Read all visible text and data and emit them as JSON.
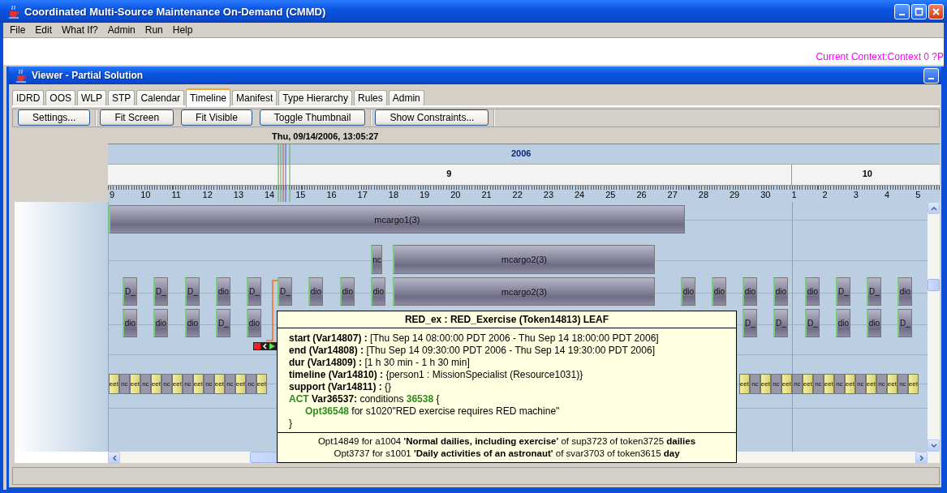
{
  "window": {
    "title": "Coordinated Multi-Source Maintenance On-Demand (CMMD)"
  },
  "menu": [
    "File",
    "Edit",
    "What If?",
    "Admin",
    "Run",
    "Help"
  ],
  "context_label": "Current Context:Context 0 ?P",
  "viewer": {
    "title": "Viewer - Partial Solution"
  },
  "tabs": [
    {
      "label": "IDRD",
      "selected": false
    },
    {
      "label": "OOS",
      "selected": false
    },
    {
      "label": "WLP",
      "selected": false
    },
    {
      "label": "STP",
      "selected": false
    },
    {
      "label": "Calendar",
      "selected": false
    },
    {
      "label": "Timeline",
      "selected": true
    },
    {
      "label": "Manifest",
      "selected": false
    },
    {
      "label": "Type Hierarchy",
      "selected": false
    },
    {
      "label": "Rules",
      "selected": false
    },
    {
      "label": "Admin",
      "selected": false
    }
  ],
  "toolbar": {
    "groups": [
      {
        "buttons": [
          "Settings..."
        ]
      },
      {
        "buttons": [
          "Fit Screen",
          "Fit Visible",
          "Toggle Thumbnail"
        ]
      },
      {
        "buttons": [
          "Show Constraints..."
        ]
      }
    ]
  },
  "timeline": {
    "cursor_time": "Thu, 09/14/2006, 13:05:27",
    "year": "2006",
    "months": [
      {
        "label": "9"
      },
      {
        "label": "10"
      }
    ],
    "days": [
      "9",
      "10",
      "11",
      "12",
      "13",
      "14",
      "15",
      "16",
      "17",
      "18",
      "19",
      "20",
      "21",
      "22",
      "23",
      "24",
      "25",
      "26",
      "27",
      "28",
      "29",
      "30",
      "1",
      "2",
      "3",
      "4",
      "5"
    ],
    "lanes": [
      {
        "tokens": [
          {
            "kind": "bar",
            "label": "mcargo1(3)"
          }
        ]
      },
      {
        "tokens": [
          {
            "kind": "block",
            "label": "nc"
          },
          {
            "kind": "bar",
            "label": "mcargo2(3)"
          }
        ]
      },
      {
        "tokens": [
          {
            "kind": "block",
            "label": "D_"
          },
          {
            "kind": "block",
            "label": "D_"
          },
          {
            "kind": "block",
            "label": "D_"
          },
          {
            "kind": "block",
            "label": "dio"
          },
          {
            "kind": "block",
            "label": "D_"
          },
          {
            "kind": "block",
            "label": "D_"
          },
          {
            "kind": "block",
            "label": "dio"
          },
          {
            "kind": "block",
            "label": "dio"
          },
          {
            "kind": "block",
            "label": "dio"
          },
          {
            "kind": "bar",
            "label": "mcargo2(3)"
          },
          {
            "kind": "block",
            "label": "dio"
          },
          {
            "kind": "block",
            "label": "dio"
          },
          {
            "kind": "block",
            "label": "dio"
          },
          {
            "kind": "block",
            "label": "dio"
          },
          {
            "kind": "block",
            "label": "dio"
          },
          {
            "kind": "block",
            "label": "D_"
          },
          {
            "kind": "block",
            "label": "D_"
          },
          {
            "kind": "block",
            "label": "dio"
          }
        ]
      },
      {
        "tokens": [
          {
            "kind": "block",
            "label": "dio"
          },
          {
            "kind": "block",
            "label": "dio"
          },
          {
            "kind": "block",
            "label": "dio"
          },
          {
            "kind": "block",
            "label": "D_"
          },
          {
            "kind": "block",
            "label": "dio"
          },
          {
            "kind": "block",
            "label": "D_"
          },
          {
            "kind": "block",
            "label": "D_"
          },
          {
            "kind": "block",
            "label": "D_"
          },
          {
            "kind": "block",
            "label": "dio"
          },
          {
            "kind": "block",
            "label": "dio"
          },
          {
            "kind": "block",
            "label": "D_"
          }
        ]
      },
      {
        "tokens": [
          {
            "kind": "note",
            "label": "eet"
          },
          {
            "kind": "stub",
            "label": "nc"
          },
          {
            "kind": "note",
            "label": "eet"
          },
          {
            "kind": "stub",
            "label": "nc"
          },
          {
            "kind": "note",
            "label": "eet"
          },
          {
            "kind": "stub",
            "label": "nc"
          },
          {
            "kind": "note",
            "label": "eet"
          },
          {
            "kind": "stub",
            "label": "nc"
          },
          {
            "kind": "note",
            "label": "eet"
          },
          {
            "kind": "stub",
            "label": "nc"
          },
          {
            "kind": "note",
            "label": "eet"
          },
          {
            "kind": "stub",
            "label": "nc"
          },
          {
            "kind": "note",
            "label": "eet"
          },
          {
            "kind": "stub",
            "label": "nc"
          },
          {
            "kind": "note",
            "label": "eet"
          },
          {
            "kind": "note",
            "label": "eet"
          },
          {
            "kind": "stub",
            "label": "nc"
          },
          {
            "kind": "note",
            "label": "eet"
          },
          {
            "kind": "stub",
            "label": "nc"
          },
          {
            "kind": "note",
            "label": "eet"
          },
          {
            "kind": "stub",
            "label": "nc"
          },
          {
            "kind": "note",
            "label": "eet"
          },
          {
            "kind": "stub",
            "label": "nc"
          },
          {
            "kind": "note",
            "label": "eet"
          },
          {
            "kind": "stub",
            "label": "nc"
          },
          {
            "kind": "note",
            "label": "eet"
          },
          {
            "kind": "stub",
            "label": "nc"
          },
          {
            "kind": "note",
            "label": "eet"
          },
          {
            "kind": "stub",
            "label": "nc"
          },
          {
            "kind": "note",
            "label": "eet"
          },
          {
            "kind": "stub",
            "label": "nc"
          },
          {
            "kind": "note",
            "label": "eet"
          }
        ]
      }
    ]
  },
  "tooltip": {
    "title": "RED_ex : RED_Exercise (Token14813) LEAF",
    "lines": [
      {
        "segments": [
          {
            "kind": "label",
            "text": "start (Var14807) : "
          },
          {
            "kind": "plain",
            "text": " [Thu Sep 14 08:00:00 PDT 2006 - Thu Sep 14 18:00:00 PDT 2006]"
          }
        ]
      },
      {
        "segments": [
          {
            "kind": "label",
            "text": "end (Var14808) : "
          },
          {
            "kind": "plain",
            "text": " [Thu Sep 14 09:30:00 PDT 2006 - Thu Sep 14 19:30:00 PDT 2006]"
          }
        ]
      },
      {
        "segments": [
          {
            "kind": "label",
            "text": "dur (Var14809) : "
          },
          {
            "kind": "plain",
            "text": " [1 h 30 min - 1 h 30 min]"
          }
        ]
      },
      {
        "segments": [
          {
            "kind": "label",
            "text": "timeline (Var14810) : "
          },
          {
            "kind": "plain",
            "text": "  {person1 : MissionSpecialist (Resource1031)}"
          }
        ]
      },
      {
        "segments": [
          {
            "kind": "label",
            "text": "support (Var14811) : "
          },
          {
            "kind": "plain",
            "text": "  {}"
          }
        ]
      },
      {
        "segments": [
          {
            "kind": "accent",
            "text": "ACT "
          },
          {
            "kind": "label",
            "text": "Var36537:"
          },
          {
            "kind": "plain",
            "text": " conditions "
          },
          {
            "kind": "accent",
            "text": "36538"
          },
          {
            "kind": "plain",
            "text": " {"
          }
        ],
        "children": [
          {
            "segments": [
              {
                "kind": "accent",
                "text": "Opt36548"
              },
              {
                "kind": "plain",
                "text": " for s1020\"RED exercise requires RED machine\""
              }
            ]
          }
        ]
      },
      {
        "segments": [
          {
            "kind": "plain",
            "text": "}"
          }
        ]
      }
    ],
    "footer": [
      "Opt14849 for a1004 **'Normal dailies, including exercise'** of sup3723 of token3725 **dailies**",
      "Opt3737 for s1001 **'Daily activities of an astronaut'** of svar3703 of token3615 **day**"
    ]
  }
}
